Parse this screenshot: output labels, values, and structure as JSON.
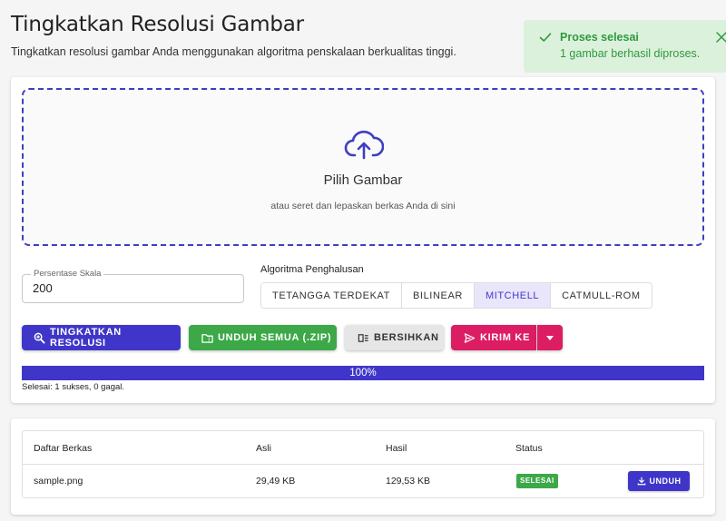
{
  "page": {
    "title": "Tingkatkan Resolusi Gambar",
    "subtitle": "Tingkatkan resolusi gambar Anda menggunakan algoritma penskalaan berkualitas tinggi."
  },
  "toast": {
    "title": "Proses selesai",
    "message": "1 gambar berhasil diproses.",
    "color": "#2e9a3e"
  },
  "dropzone": {
    "icon": "cloud-upload-icon",
    "title": "Pilih Gambar",
    "subtitle": "atau seret dan lepaskan berkas Anda di sini"
  },
  "scale": {
    "label": "Persentase Skala",
    "value": "200"
  },
  "algorithm": {
    "label": "Algoritma Penghalusan",
    "options": [
      "TETANGGA TERDEKAT",
      "BILINEAR",
      "MITCHELL",
      "CATMULL-ROM"
    ],
    "selected": "MITCHELL"
  },
  "actions": {
    "upscale": "TINGKATKAN RESOLUSI",
    "download_zip": "UNDUH SEMUA (.ZIP)",
    "clear": "BERSIHKAN",
    "send": "KIRIM KE"
  },
  "progress": {
    "percent": 100,
    "label": "100%",
    "status": "Selesai: 1 sukses, 0 gagal."
  },
  "table": {
    "columns": [
      "Daftar Berkas",
      "Asli",
      "Hasil",
      "Status"
    ],
    "rows": [
      {
        "file": "sample.png",
        "original": "29,49 KB",
        "result": "129,53 KB",
        "status": "SELESAI",
        "action": "UNDUH"
      }
    ]
  },
  "colors": {
    "primary": "#3f36c9",
    "success": "#3ca848",
    "danger": "#dd1d63",
    "neutral": "#e6e6e6"
  }
}
